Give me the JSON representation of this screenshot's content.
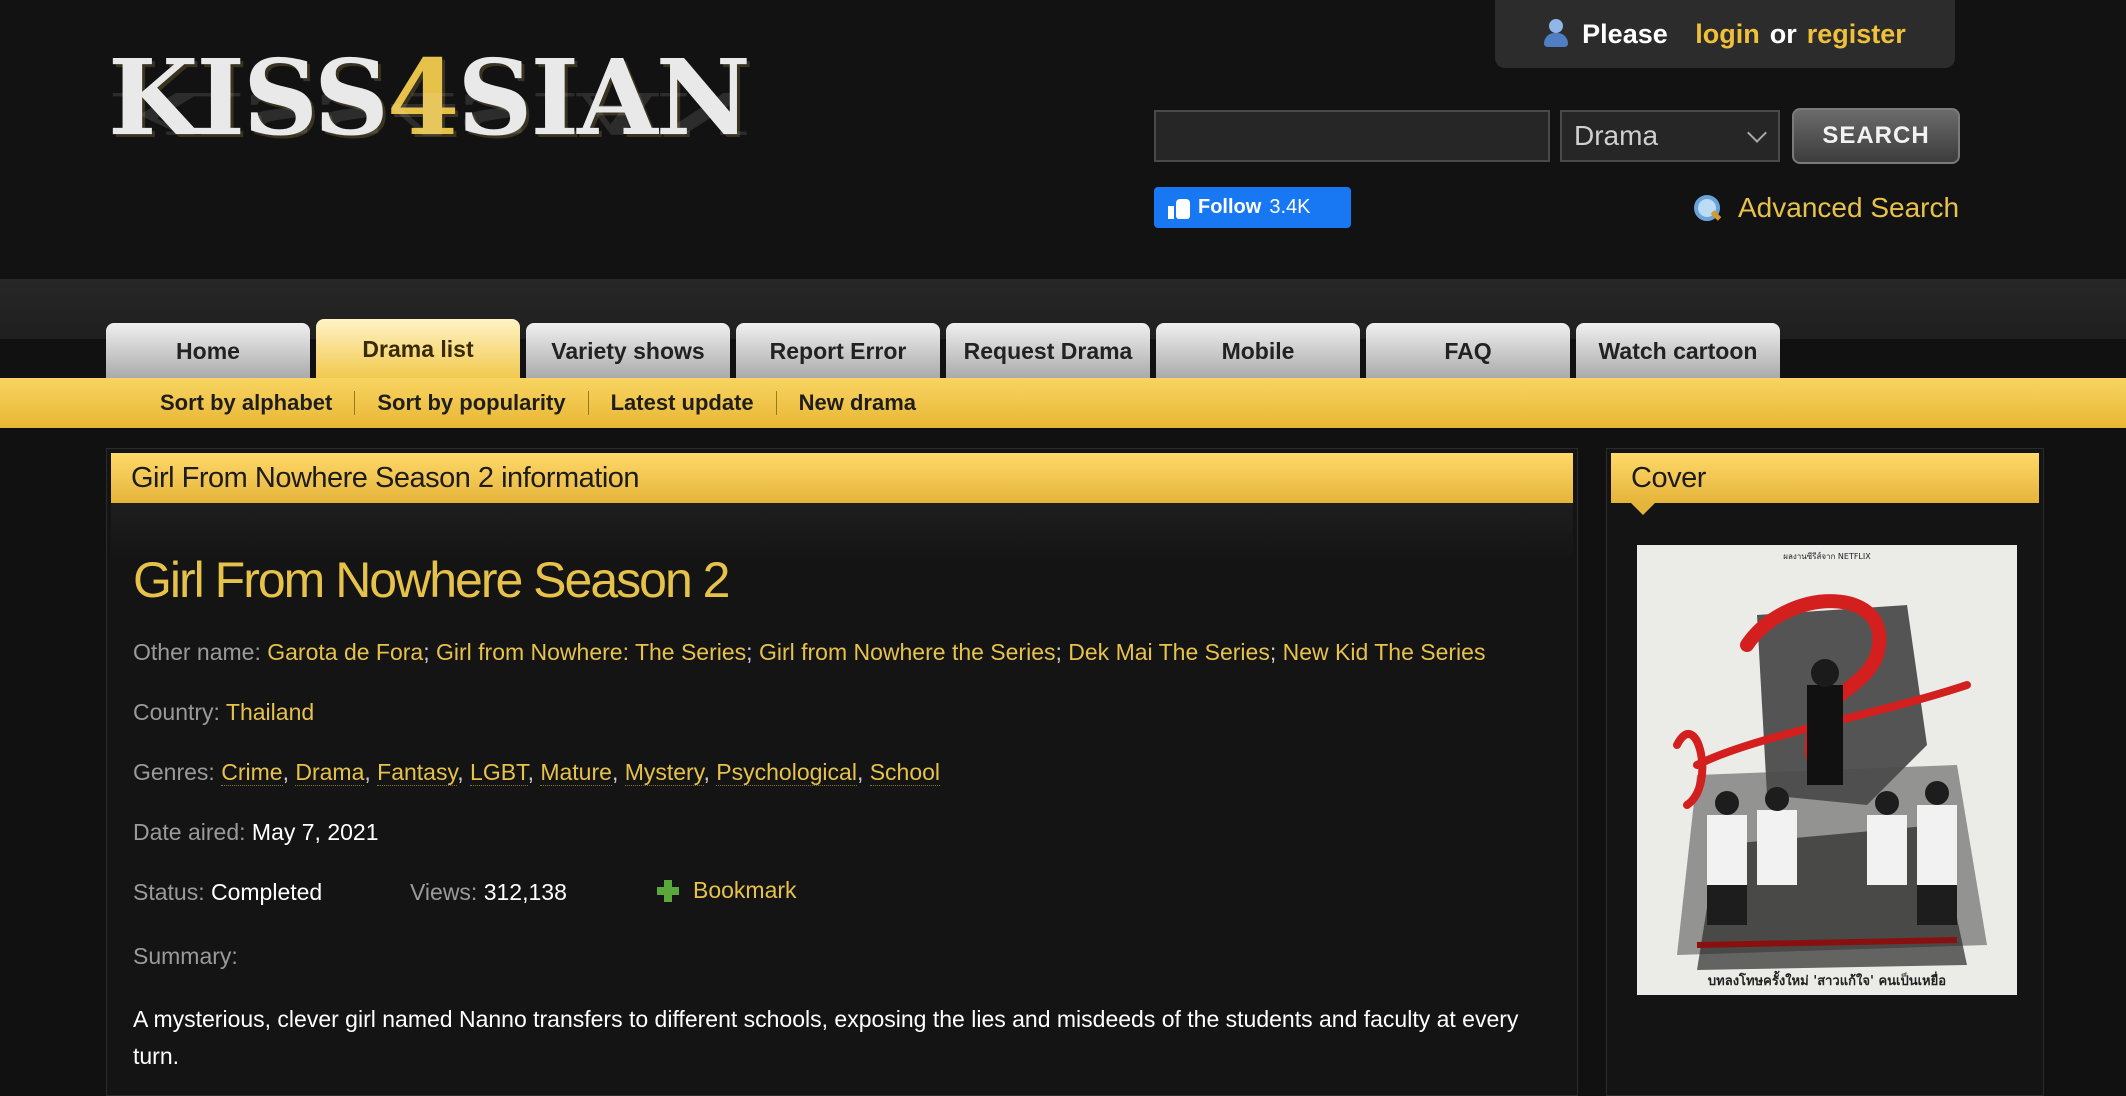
{
  "header": {
    "logo_part1": "KISS",
    "logo_part2": "4",
    "logo_part3": "SIAN",
    "login": {
      "please": "Please",
      "login": "login",
      "or": "or",
      "register": "register"
    },
    "search": {
      "placeholder": "",
      "category": "Drama",
      "button": "SEARCH"
    },
    "facebook": {
      "label": "Follow",
      "count": "3.4K"
    },
    "advanced_search": "Advanced Search"
  },
  "nav": {
    "tabs": [
      {
        "label": "Home"
      },
      {
        "label": "Drama list",
        "active": true
      },
      {
        "label": "Variety shows"
      },
      {
        "label": "Report Error"
      },
      {
        "label": "Request Drama"
      },
      {
        "label": "Mobile"
      },
      {
        "label": "FAQ"
      },
      {
        "label": "Watch cartoon"
      }
    ],
    "subnav": [
      "Sort by alphabet",
      "Sort by popularity",
      "Latest update",
      "New drama"
    ]
  },
  "info": {
    "panel_title": "Girl From Nowhere Season 2 information",
    "title": "Girl From Nowhere Season 2",
    "other_name_label": "Other name:",
    "other_names": [
      "Garota de Fora",
      "Girl from Nowhere: The Series",
      "Girl from Nowhere the Series",
      "Dek Mai The Series",
      "New Kid The Series"
    ],
    "country_label": "Country:",
    "country": "Thailand",
    "genres_label": "Genres:",
    "genres": [
      "Crime",
      "Drama",
      "Fantasy",
      "LGBT",
      "Mature",
      "Mystery",
      "Psychological",
      "School"
    ],
    "date_label": "Date aired:",
    "date": "May 7, 2021",
    "status_label": "Status:",
    "status": "Completed",
    "views_label": "Views:",
    "views": "312,138",
    "bookmark": "Bookmark",
    "summary_label": "Summary:",
    "summary": "A mysterious, clever girl named Nanno transfers to different schools, exposing the lies and misdeeds of the students and faculty at every turn."
  },
  "cover": {
    "panel_title": "Cover",
    "poster_top_text": "ผลงานซีรีส์จาก NETFLIX",
    "poster_bottom_text": "บทลงโทษครั้งใหม่ 'สาวแก้ใจ' คนเป็นเหยื่อ"
  },
  "colors": {
    "gold": "#e7c24a",
    "background": "#111111",
    "facebook": "#1877f2"
  }
}
